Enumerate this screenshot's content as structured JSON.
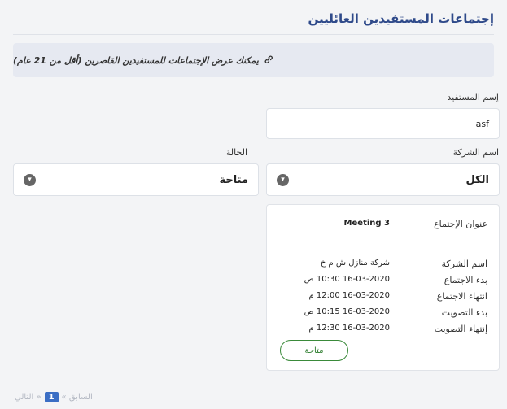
{
  "page": {
    "title": "إجتماعات المستفيدين العائليين",
    "info_text": "يمكنك عرض الإجتماعات للمستفيدين القاصرين (أقل من 21 عام)",
    "info_icon": "link-icon"
  },
  "form": {
    "beneficiary_label": "إسم المستفيد",
    "beneficiary_value": "asf",
    "company_label": "اسم الشركة",
    "company_value": "الكل",
    "status_label": "الحالة",
    "status_value": "متاحة"
  },
  "meeting": {
    "title_label": "عنوان الإجتماع",
    "title_value": "Meeting 3",
    "company_label": "اسم الشركة",
    "company_value": "شركة منازل ش م خ",
    "start_label": "بدء الاجتماع",
    "start_value": "16-03-2020 10:30 ص",
    "end_label": "انتهاء الاجتماع",
    "end_value": "16-03-2020 12:00 م",
    "vote_start_label": "بدء التصويت",
    "vote_start_value": "16-03-2020 10:15 ص",
    "vote_end_label": "إنتهاء التصويت",
    "vote_end_value": "16-03-2020 12:30 م",
    "status_button": "متاحة"
  },
  "pager": {
    "prev": "« السابق",
    "current": "1",
    "next": "التالي »"
  },
  "colors": {
    "title": "#2f4a8a",
    "status_green": "#3a8a3a",
    "pager_active": "#3b6ec4"
  }
}
